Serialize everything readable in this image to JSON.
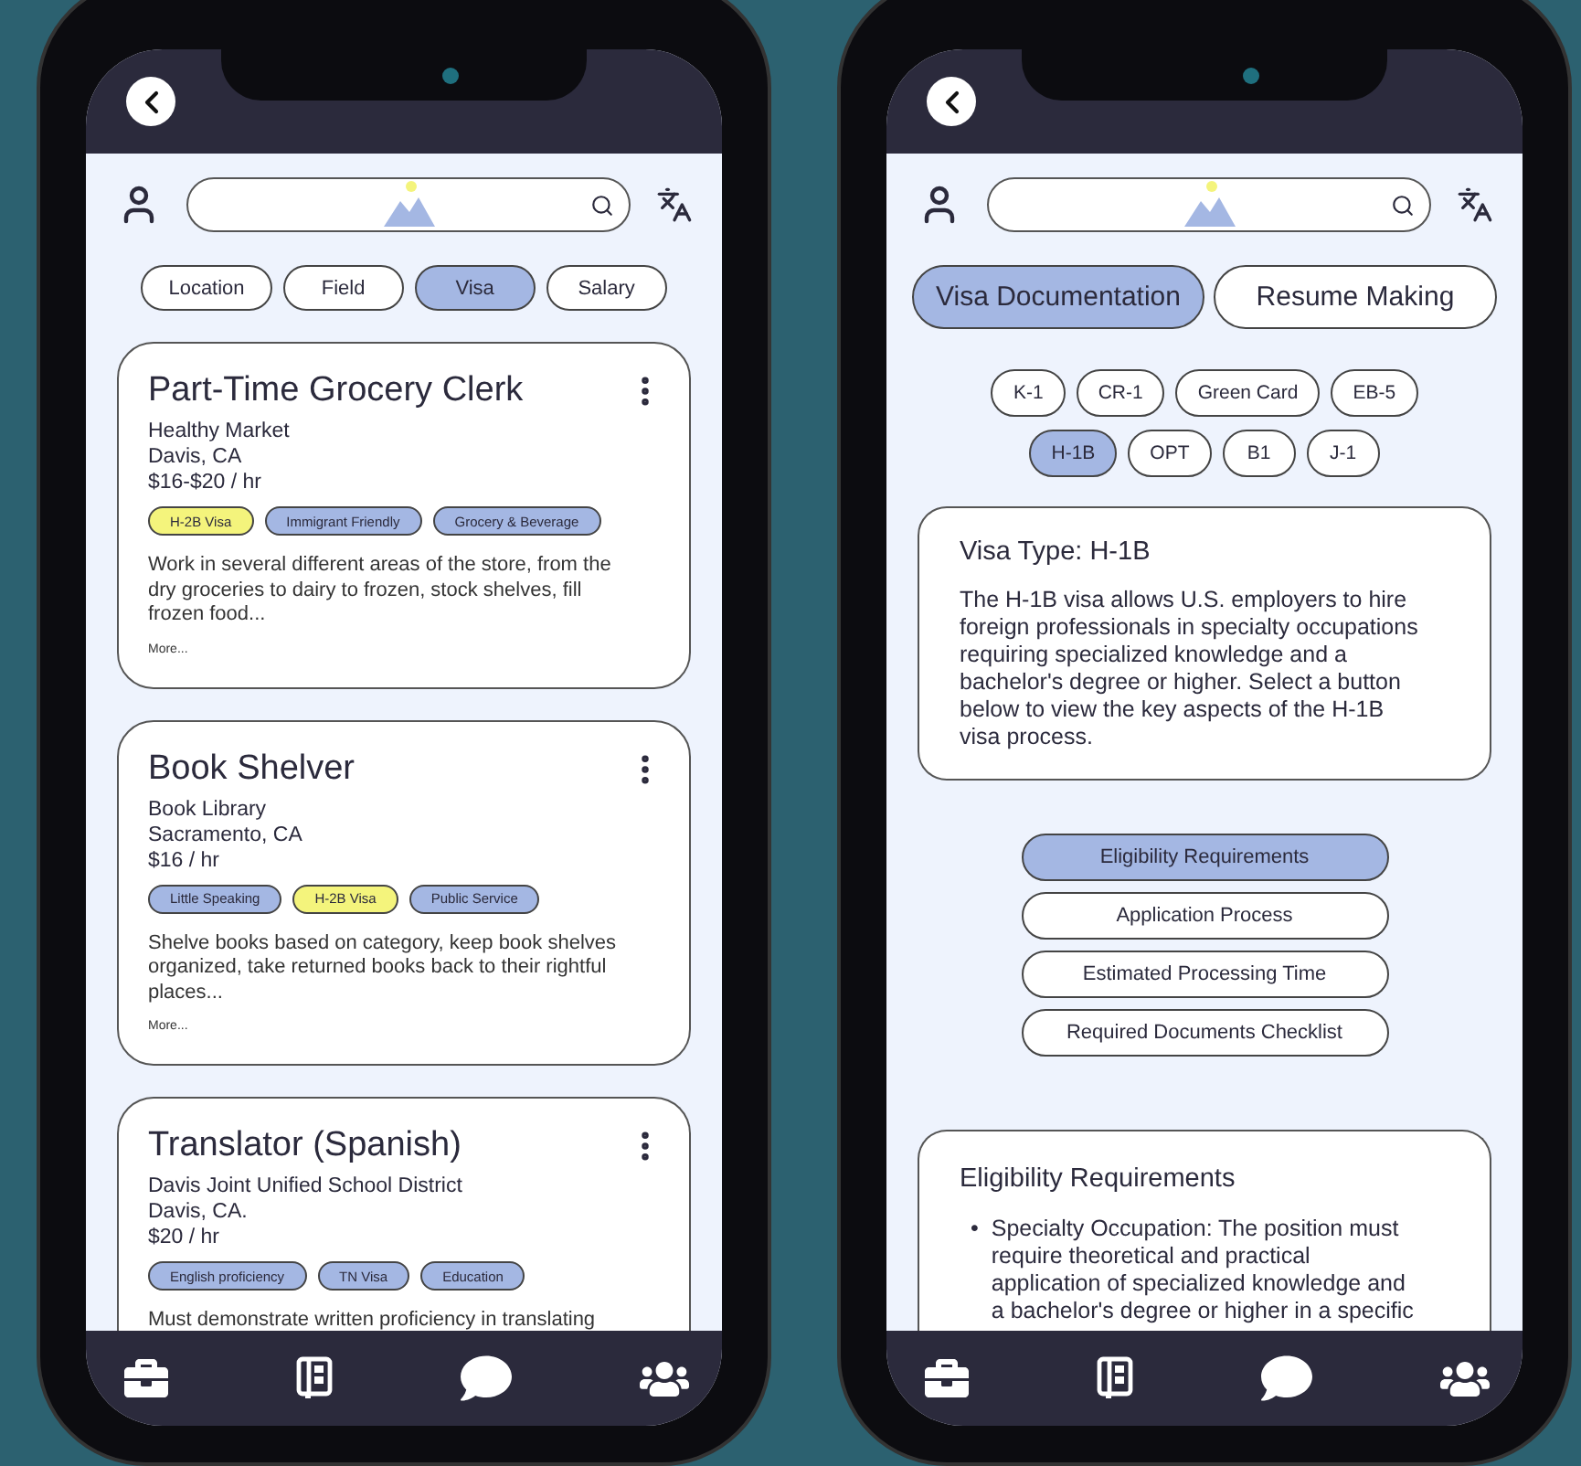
{
  "jobs_screen": {
    "filters": [
      {
        "label": "Location",
        "selected": false
      },
      {
        "label": "Field",
        "selected": false
      },
      {
        "label": "Visa",
        "selected": true
      },
      {
        "label": "Salary",
        "selected": false
      }
    ],
    "jobs": [
      {
        "title": "Part-Time Grocery Clerk",
        "employer": "Healthy Market",
        "location": "Davis, CA",
        "pay": "$16-$20 / hr",
        "tags": [
          {
            "label": "H-2B Visa",
            "color": "#f4f47c"
          },
          {
            "label": "Immigrant Friendly",
            "color": "#a4b7e3"
          },
          {
            "label": "Grocery & Beverage",
            "color": "#a4b7e3"
          }
        ],
        "description": "Work in several different areas of the store, from the dry groceries to dairy to frozen, stock shelves, fill frozen food...",
        "more": "More..."
      },
      {
        "title": "Book Shelver",
        "employer": "Book Library",
        "location": "Sacramento, CA",
        "pay": "$16 / hr",
        "tags": [
          {
            "label": "Little Speaking",
            "color": "#a4b7e3"
          },
          {
            "label": "H-2B Visa",
            "color": "#f4f47c"
          },
          {
            "label": "Public Service",
            "color": "#a4b7e3"
          }
        ],
        "description": "Shelve books based on category, keep book shelves organized, take returned books back to their rightful places...",
        "more": "More..."
      },
      {
        "title": "Translator (Spanish)",
        "employer": "Davis Joint Unified School District",
        "location": "Davis, CA.",
        "pay": "$20 / hr",
        "tags": [
          {
            "label": "English proficiency",
            "color": "#a4b7e3"
          },
          {
            "label": "TN Visa",
            "color": "#a4b7e3"
          },
          {
            "label": "Education",
            "color": "#a4b7e3"
          }
        ],
        "description": "Must demonstrate written proficiency in translating"
      }
    ]
  },
  "visa_screen": {
    "sections": [
      {
        "label": "Visa Documentation",
        "selected": true
      },
      {
        "label": "Resume Making",
        "selected": false
      }
    ],
    "visa_types": [
      [
        {
          "label": "K-1",
          "selected": false
        },
        {
          "label": "CR-1",
          "selected": false
        },
        {
          "label": "Green Card",
          "selected": false
        },
        {
          "label": "EB-5",
          "selected": false
        }
      ],
      [
        {
          "label": "H-1B",
          "selected": true
        },
        {
          "label": "OPT",
          "selected": false
        },
        {
          "label": "B1",
          "selected": false
        },
        {
          "label": "J-1",
          "selected": false
        }
      ]
    ],
    "info": {
      "title": "Visa Type: H-1B",
      "body": "The H-1B visa allows U.S. employers to hire foreign professionals in specialty occupations requiring specialized knowledge and a bachelor's degree or higher. Select a button below to view the key aspects of the H-1B visa process."
    },
    "topics": [
      {
        "label": "Eligibility Requirements",
        "selected": true
      },
      {
        "label": "Application Process",
        "selected": false
      },
      {
        "label": "Estimated Processing Time",
        "selected": false
      },
      {
        "label": "Required Documents Checklist",
        "selected": false
      }
    ],
    "detail": {
      "title": "Eligibility Requirements",
      "bullets": [
        {
          "marker": "•",
          "text": "Specialty Occupation: The position must require theoretical and practical application of specialized knowledge and a bachelor's degree or higher in a specific"
        }
      ]
    }
  }
}
